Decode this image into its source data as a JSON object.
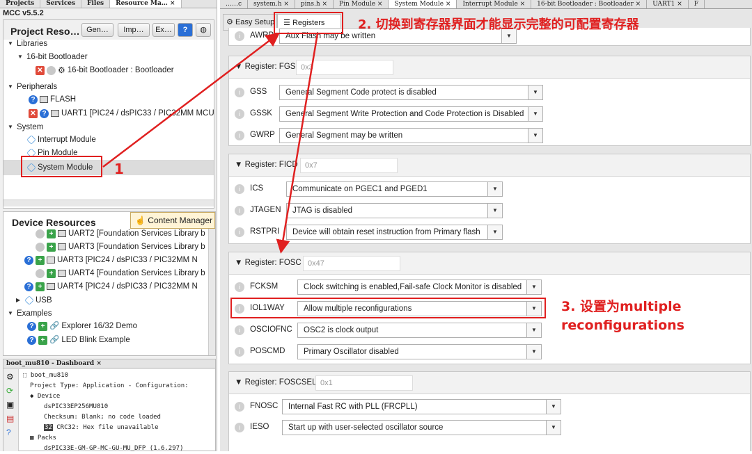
{
  "left": {
    "tabs": [
      "Projects",
      "Services",
      "Files",
      "Resource Ma… ×"
    ],
    "mcc_version": "MCC v5.5.2",
    "project_resources": {
      "title": "Project Reso…",
      "buttons": [
        "Gen…",
        "Imp…",
        "Ex…"
      ],
      "tree": {
        "libraries": "Libraries",
        "bootloader_group": "16-bit Bootloader",
        "bootloader_item": "16-bit Bootloader : Bootloader",
        "peripherals": "Peripherals",
        "flash": "FLASH",
        "uart1": "UART1 [PIC24 / dsPIC33 / PIC32MM MCU",
        "system": "System",
        "interrupt": "Interrupt Module",
        "pin": "Pin Module",
        "system_module": "System Module"
      }
    },
    "device_resources": {
      "title": "Device Resources",
      "content_manager": "Content Manager",
      "items": [
        "UART2 [Foundation Services Library b",
        "UART3 [Foundation Services Library b",
        "UART3 [PIC24 / dsPIC33 / PIC32MM N",
        "UART4 [Foundation Services Library b",
        "UART4 [PIC24 / dsPIC33 / PIC32MM N"
      ],
      "usb": "USB",
      "examples": "Examples",
      "example_items": [
        "Explorer 16/32 Demo",
        "LED Blink Example"
      ]
    },
    "dashboard": {
      "tab": "boot_mu810 - Dashboard ×",
      "project": "boot_mu810",
      "project_type": "Project Type: Application - Configuration:",
      "device": "Device",
      "device_name": "dsPIC33EP256MU810",
      "checksum": "Checksum: Blank; no code loaded",
      "crc_badge": "32",
      "crc": "CRC32: Hex file unavailable",
      "packs": "Packs",
      "pack_name": "dsPIC33E-GM-GP-MC-GU-MU_DFP (1.6.297)"
    }
  },
  "right": {
    "tabs": [
      "……c",
      "system.h ×",
      "pins.h ×",
      "Pin Module ×",
      "System Module ×",
      "Interrupt Module ×",
      "16-bit Bootloader : Bootloader ×",
      "UART1 ×",
      "F"
    ],
    "view_tabs": [
      "Easy Setup",
      "Registers"
    ],
    "top_row": {
      "label": "AWRP",
      "value": "Aux Flash may be written"
    },
    "registers": [
      {
        "title": "Register: FGS",
        "value": "0x3",
        "rows": [
          {
            "label": "GSS",
            "value": "General Segment Code protect is disabled"
          },
          {
            "label": "GSSK",
            "value": "General Segment Write Protection and Code Protection is Disabled"
          },
          {
            "label": "GWRP",
            "value": "General Segment may be written"
          }
        ]
      },
      {
        "title": "Register: FICD",
        "value": "0x7",
        "rows": [
          {
            "label": "ICS",
            "value": "Communicate on PGEC1 and PGED1"
          },
          {
            "label": "JTAGEN",
            "value": "JTAG is disabled"
          },
          {
            "label": "RSTPRI",
            "value": "Device will obtain reset instruction from Primary flash"
          }
        ]
      },
      {
        "title": "Register: FOSC",
        "value": "0x47",
        "rows": [
          {
            "label": "FCKSM",
            "value": "Clock switching is enabled,Fail-safe Clock Monitor is disabled"
          },
          {
            "label": "IOL1WAY",
            "value": "Allow multiple reconfigurations"
          },
          {
            "label": "OSCIOFNC",
            "value": "OSC2 is clock output"
          },
          {
            "label": "POSCMD",
            "value": "Primary Oscillator disabled"
          }
        ]
      },
      {
        "title": "Register: FOSCSEL",
        "value": "0x1",
        "rows": [
          {
            "label": "FNOSC",
            "value": "Internal Fast RC with PLL (FRCPLL)"
          },
          {
            "label": "IESO",
            "value": "Start up with user-selected oscillator source"
          }
        ]
      }
    ]
  },
  "annotations": {
    "step1": "1",
    "step2": "2. 切换到寄存器界面才能显示完整的可配置寄存器",
    "step3_line1": "3. 设置为multiple",
    "step3_line2": "reconfigurations"
  }
}
